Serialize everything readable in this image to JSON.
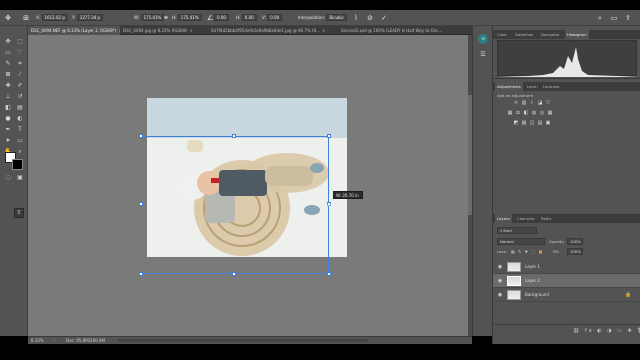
{
  "options_bar": {
    "x_label": "X:",
    "x_value": "1612.02 p",
    "y_label": "Y:",
    "y_value": "1277.34 p",
    "w_label": "W:",
    "w_value": "175.41%",
    "h_label": "H:",
    "h_value": "175.41%",
    "angle_value": "0.00",
    "h_skew_label": "H:",
    "h_skew_value": "0.00",
    "v_skew_label": "V:",
    "v_skew_value": "0.00",
    "interpolation_label": "Interpolation:",
    "interpolation_value": "Bicubic",
    "warp_icon": "warp-icon",
    "cancel_icon": "cancel-icon",
    "commit_icon": "checkmark-icon"
  },
  "document_tabs": [
    {
      "label": "DSC_6094.NEF @ 8.33% (Layer 2, RGB/8*)",
      "active": true
    },
    {
      "label": "DSC_6094.jpg @ 8.33% (RGB/8)",
      "active": false
    },
    {
      "label": "5d7f4d2bbb4f954e9c6c9a9b8a4de1.jpg @ 96.7% (R...",
      "active": false
    },
    {
      "label": "Second2.psd @ 100% (LEADY Is Halt  Way to  Onc...",
      "active": false
    }
  ],
  "transform_tooltip": "W: 26.70 in",
  "status_bar": {
    "zoom": "8.33%",
    "doc_info": "Doc: 95.8M/260.4M"
  },
  "panel_strip_icons": [
    "history-icon",
    "properties-icon"
  ],
  "histogram_panel": {
    "tabs": [
      "Color",
      "Swatches",
      "Navigator",
      "Histogram"
    ],
    "active_tab": "Histogram"
  },
  "adjustments_panel": {
    "tabs": [
      "Adjustments",
      "Learn",
      "Libraries"
    ],
    "active_tab": "Adjustments",
    "caption": "Add an adjustment"
  },
  "layers_panel": {
    "tabs": [
      "Layers",
      "Channels",
      "Paths"
    ],
    "active_tab": "Layers",
    "kind_label": "Kind",
    "blend_mode": "Normal",
    "opacity_label": "Opacity:",
    "opacity_value": "100%",
    "lock_label": "Lock:",
    "fill_label": "Fill:",
    "fill_value": "100%",
    "layers": [
      {
        "name": "Layer 1",
        "selected": false
      },
      {
        "name": "Layer 2",
        "selected": true
      },
      {
        "name": "Background",
        "selected": false
      }
    ]
  }
}
